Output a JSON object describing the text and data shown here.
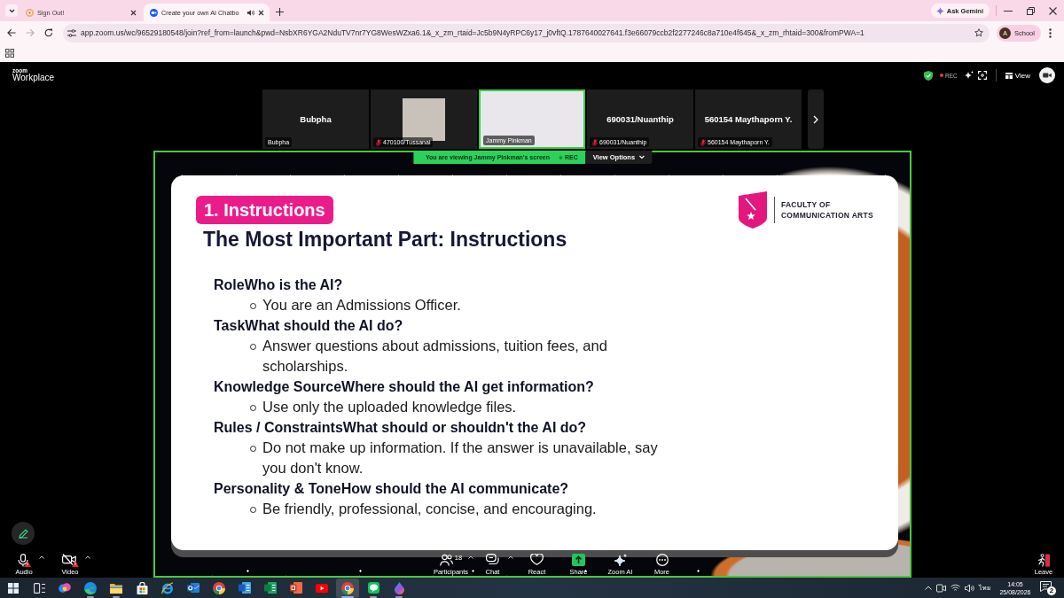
{
  "browser": {
    "tabs": [
      {
        "title": "Sign Out!",
        "selected": false,
        "audio": false
      },
      {
        "title": "Create your own AI Chatbo",
        "selected": true,
        "audio": true
      }
    ],
    "ask_gemini": "Ask Gemini",
    "forward_button": {
      "disabled": true
    },
    "url": "app.zoom.us/wc/96529180548/join?ref_from=launch&pwd=NsbXR6YGA2NduTV7nr7YG8WesWZxa6.1&_x_zm_rtaid=Jc5b9N4yRPC6y17_j0vftQ.1787640027641.f3e66079ccb2f2277246c8a710e4f645&_x_zm_rhtaid=300&fromPWA=1",
    "profile": {
      "initial": "A",
      "label": "School"
    }
  },
  "zoom": {
    "brand": {
      "small": "zoom",
      "large": "Workplace"
    },
    "recording": "REC",
    "view": "View",
    "participants": [
      {
        "kind": "name",
        "name": "Bubpha",
        "label": "Bubpha",
        "muted": false,
        "speaking": false
      },
      {
        "kind": "photo",
        "label": "470100/Tussanai",
        "muted": true,
        "speaking": false
      },
      {
        "kind": "video",
        "label": "Jammy Pinkman",
        "muted": false,
        "speaking": true
      },
      {
        "kind": "name",
        "name": "690031/Nuanthip",
        "label": "690031/Nuanthip",
        "muted": true,
        "speaking": false
      },
      {
        "kind": "name",
        "name": "560154 Maythaporn Y.",
        "label": "560154 Maythaporn Y.",
        "muted": true,
        "speaking": false
      }
    ],
    "share_banner": {
      "text": "You are viewing Jammy Pinkman's screen",
      "rec": "REC",
      "view_options": "View Options"
    },
    "slide": {
      "tag": "1. Instructions",
      "title": "The Most Important Part: Instructions",
      "logo_text": [
        "FACULTY OF",
        "COMMUNICATION ARTS"
      ],
      "items": [
        {
          "text": "RoleWho is the AI?",
          "children": [
            {
              "text": "You are an Admissions Officer."
            }
          ]
        },
        {
          "text": "TaskWhat should the AI do?",
          "children": [
            {
              "text": "Answer questions about admissions, tuition fees, and scholarships."
            }
          ]
        },
        {
          "text": "Knowledge SourceWhere should the AI get information?",
          "children": [
            {
              "text": "Use only the uploaded knowledge files."
            }
          ]
        },
        {
          "text": "Rules / ConstraintsWhat should or shouldn't the AI do?",
          "children": [
            {
              "text": "Do not make up information. If the answer is unavailable, say you don't know."
            }
          ]
        },
        {
          "text": "Personality & ToneHow should the AI communicate?",
          "children": [
            {
              "text": "Be friendly, professional, concise, and encouraging."
            }
          ]
        }
      ]
    },
    "toolbar": {
      "left": [
        {
          "kind": "audio",
          "label": "Audio",
          "off": false,
          "warning": true,
          "has_menu": true
        },
        {
          "kind": "video",
          "label": "Video",
          "off": true,
          "warning": true,
          "has_menu": true
        }
      ],
      "center": [
        {
          "kind": "participants",
          "label": "Participants",
          "count": "18",
          "has_menu": true
        },
        {
          "kind": "chat",
          "label": "Chat",
          "has_menu": true
        },
        {
          "kind": "react",
          "label": "React",
          "has_menu": false
        },
        {
          "kind": "share",
          "label": "Share",
          "has_menu": false
        },
        {
          "kind": "zoom_ai",
          "label": "Zoom AI",
          "has_menu": false
        },
        {
          "kind": "more",
          "label": "More",
          "has_menu": false
        }
      ],
      "right": [
        {
          "kind": "leave",
          "label": "Leave",
          "has_menu": false
        }
      ]
    }
  },
  "taskbar": {
    "apps": [
      {
        "kind": "start",
        "running": false,
        "selected": false
      },
      {
        "kind": "task_view",
        "running": false,
        "selected": false
      },
      {
        "kind": "copilot",
        "running": false,
        "selected": false
      },
      {
        "kind": "edge",
        "running": true,
        "selected": false
      },
      {
        "kind": "explorer",
        "running": true,
        "selected": false
      },
      {
        "kind": "store",
        "running": false,
        "selected": false
      },
      {
        "kind": "ie",
        "running": false,
        "selected": false
      },
      {
        "kind": "outlook",
        "running": false,
        "selected": false
      },
      {
        "kind": "chrome",
        "running": false,
        "selected": false
      },
      {
        "kind": "word",
        "running": false,
        "selected": false
      },
      {
        "kind": "excel",
        "running": false,
        "selected": false
      },
      {
        "kind": "powerpoint",
        "running": false,
        "selected": false
      },
      {
        "kind": "youtube",
        "running": false,
        "selected": false
      },
      {
        "kind": "chrome",
        "running": true,
        "selected": true
      },
      {
        "kind": "line",
        "running": true,
        "selected": false
      },
      {
        "kind": "drop",
        "running": true,
        "selected": false
      }
    ],
    "language": "ไทย",
    "time": "14:05",
    "date": "25/08/2026",
    "notifications": "2"
  }
}
